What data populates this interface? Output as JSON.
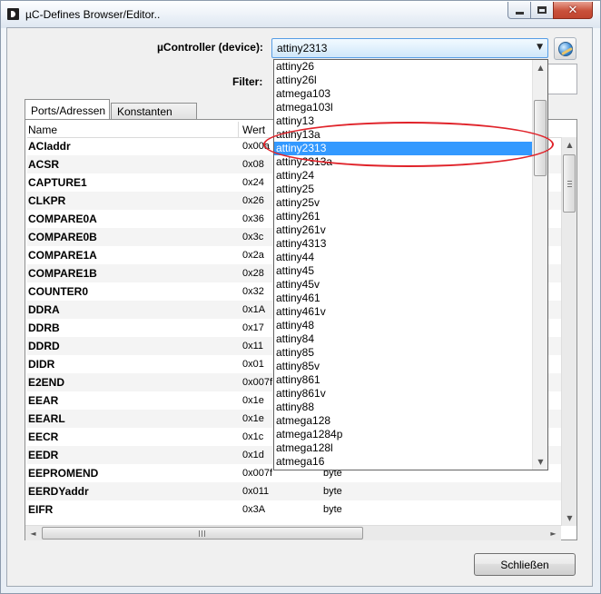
{
  "window": {
    "title": "µC-Defines Browser/Editor..",
    "close_glyph": "✕"
  },
  "device": {
    "label": "µController (device):",
    "selected": "attiny2313",
    "arrow": "▼"
  },
  "filter": {
    "label": "Filter:",
    "value": ""
  },
  "tabs": [
    {
      "label": "Ports/Adressen",
      "active": true
    },
    {
      "label": "Konstanten",
      "active": false
    }
  ],
  "table": {
    "columns": [
      "Name",
      "Wert"
    ],
    "rows": [
      {
        "name": "ACIaddr",
        "wert": "0x00a",
        "type": ""
      },
      {
        "name": "ACSR",
        "wert": "0x08",
        "type": ""
      },
      {
        "name": "CAPTURE1",
        "wert": "0x24",
        "type": ""
      },
      {
        "name": "CLKPR",
        "wert": "0x26",
        "type": ""
      },
      {
        "name": "COMPARE0A",
        "wert": "0x36",
        "type": ""
      },
      {
        "name": "COMPARE0B",
        "wert": "0x3c",
        "type": ""
      },
      {
        "name": "COMPARE1A",
        "wert": "0x2a",
        "type": ""
      },
      {
        "name": "COMPARE1B",
        "wert": "0x28",
        "type": ""
      },
      {
        "name": "COUNTER0",
        "wert": "0x32",
        "type": ""
      },
      {
        "name": "DDRA",
        "wert": "0x1A",
        "type": ""
      },
      {
        "name": "DDRB",
        "wert": "0x17",
        "type": ""
      },
      {
        "name": "DDRD",
        "wert": "0x11",
        "type": ""
      },
      {
        "name": "DIDR",
        "wert": "0x01",
        "type": ""
      },
      {
        "name": "E2END",
        "wert": "0x007f",
        "type": ""
      },
      {
        "name": "EEAR",
        "wert": "0x1e",
        "type": ""
      },
      {
        "name": "EEARL",
        "wert": "0x1e",
        "type": ""
      },
      {
        "name": "EECR",
        "wert": "0x1c",
        "type": ""
      },
      {
        "name": "EEDR",
        "wert": "0x1d",
        "type": ""
      },
      {
        "name": "EEPROMEND",
        "wert": "0x007f",
        "type": "byte"
      },
      {
        "name": "EERDYaddr",
        "wert": "0x011",
        "type": "byte"
      },
      {
        "name": "EIFR",
        "wert": "0x3A",
        "type": "byte"
      }
    ]
  },
  "dropdown": {
    "items": [
      "attiny26",
      "attiny26l",
      "atmega103",
      "atmega103l",
      "attiny13",
      "attiny13a",
      "attiny2313",
      "attiny2313a",
      "attiny24",
      "attiny25",
      "attiny25v",
      "attiny261",
      "attiny261v",
      "attiny4313",
      "attiny44",
      "attiny45",
      "attiny45v",
      "attiny461",
      "attiny461v",
      "attiny48",
      "attiny84",
      "attiny85",
      "attiny85v",
      "attiny861",
      "attiny861v",
      "attiny88",
      "atmega128",
      "atmega1284p",
      "atmega128l",
      "atmega16"
    ],
    "selected_index": 6
  },
  "scroll_glyphs": {
    "up": "▲",
    "down": "▼",
    "left": "◄",
    "right": "►"
  },
  "buttons": {
    "close_label": "Schließen"
  },
  "colors": {
    "selection": "#3399ff",
    "annotation": "#e0232a"
  }
}
